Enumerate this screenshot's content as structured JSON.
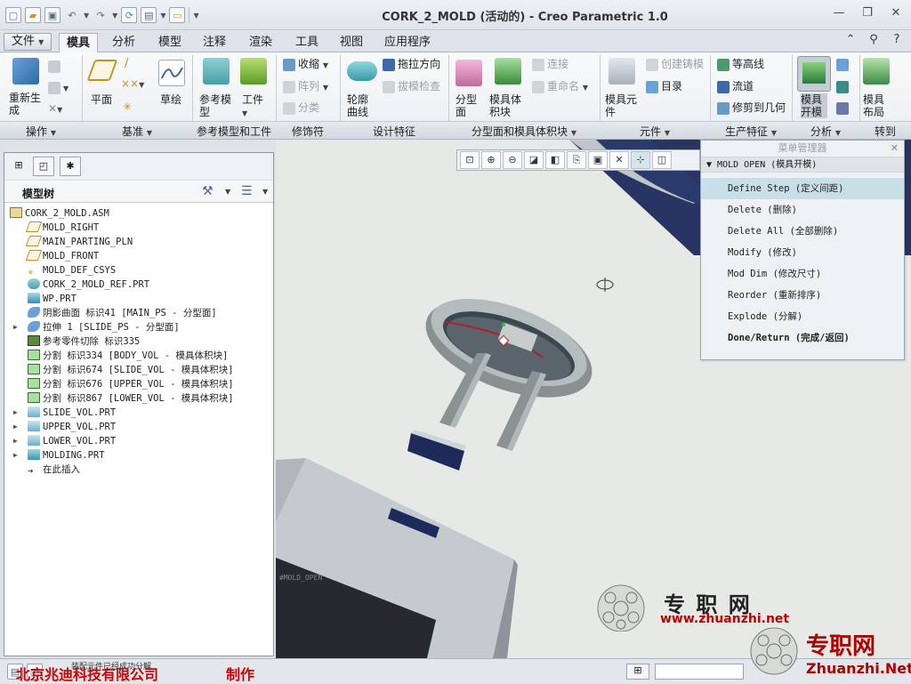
{
  "window": {
    "title": "CORK_2_MOLD (活动的) - Creo Parametric 1.0",
    "controls": [
      "—",
      "❐",
      "✕"
    ]
  },
  "qat": {
    "icons": [
      "new-file-icon",
      "open-folder-icon",
      "save-icon",
      "undo-icon",
      "redo-icon",
      "regenerate-icon",
      "windows-icon",
      "close-window-icon",
      "customize-icon"
    ]
  },
  "tabs": {
    "file": "文件",
    "items": [
      "模具",
      "分析",
      "模型",
      "注释",
      "渲染",
      "工具",
      "视图",
      "应用程序"
    ],
    "active": "模具"
  },
  "tab_icons": [
    "▲",
    "?",
    "◆",
    "?"
  ],
  "ribbon": {
    "regenerate": "重新生成",
    "plane": "平面",
    "sketch": "草绘",
    "ref_model": "参考模型",
    "workpiece": "工件",
    "shrink": "收缩",
    "array": "阵列",
    "classify": "分类",
    "outline_curve": "轮廓曲线",
    "pull_direction": "拖拉方向",
    "draft_check": "拔模检查",
    "parting_surface": "分型面",
    "mold_volume": "模具体积块",
    "connect": "连接",
    "rename": "重命名",
    "mold_component": "模具元件",
    "create_casting": "创建铸模",
    "directory": "目录",
    "contour": "等高线",
    "runner": "流道",
    "trim_to_geom": "修剪到几何",
    "mold_open": "模具开模",
    "mold_layout": "模具布局"
  },
  "groups": [
    "操作",
    "基准",
    "参考模型和工件",
    "修饰符",
    "设计特征",
    "分型面和模具体积块",
    "元件",
    "生产特征",
    "分析",
    "转到"
  ],
  "model_tree": {
    "title": "模型树",
    "items": [
      {
        "label": "CORK_2_MOLD.ASM",
        "icon": "assembly-icon",
        "indent": 0,
        "expander": false
      },
      {
        "label": "MOLD_RIGHT",
        "icon": "datum-plane-icon",
        "indent": 1,
        "expander": false
      },
      {
        "label": "MAIN_PARTING_PLN",
        "icon": "datum-plane-icon",
        "indent": 1,
        "expander": false
      },
      {
        "label": "MOLD_FRONT",
        "icon": "datum-plane-icon",
        "indent": 1,
        "expander": false
      },
      {
        "label": "MOLD_DEF_CSYS",
        "icon": "csys-icon",
        "indent": 1,
        "expander": false
      },
      {
        "label": "CORK_2_MOLD_REF.PRT",
        "icon": "ref-part-icon",
        "indent": 1,
        "expander": false
      },
      {
        "label": "WP.PRT",
        "icon": "workpiece-icon",
        "indent": 1,
        "expander": false
      },
      {
        "label": "阴影曲面 标识41 [MAIN_PS - 分型面]",
        "icon": "shadow-surface-icon",
        "indent": 1,
        "expander": false
      },
      {
        "label": "拉伸 1 [SLIDE_PS - 分型面]",
        "icon": "extrude-icon",
        "indent": 1,
        "expander": true
      },
      {
        "label": "参考零件切除 标识335",
        "icon": "ref-cut-icon",
        "indent": 1,
        "expander": false
      },
      {
        "label": "分割 标识334 [BODY_VOL - 模具体积块]",
        "icon": "split-icon",
        "indent": 1,
        "expander": false
      },
      {
        "label": "分割 标识674 [SLIDE_VOL - 模具体积块]",
        "icon": "split-icon",
        "indent": 1,
        "expander": false
      },
      {
        "label": "分割 标识676 [UPPER_VOL - 模具体积块]",
        "icon": "split-icon",
        "indent": 1,
        "expander": false
      },
      {
        "label": "分割 标识867 [LOWER_VOL - 模具体积块]",
        "icon": "split-icon",
        "indent": 1,
        "expander": false
      },
      {
        "label": "SLIDE_VOL.PRT",
        "icon": "part-icon",
        "indent": 1,
        "expander": true
      },
      {
        "label": "UPPER_VOL.PRT",
        "icon": "part-icon",
        "indent": 1,
        "expander": true
      },
      {
        "label": "LOWER_VOL.PRT",
        "icon": "part-icon",
        "indent": 1,
        "expander": true
      },
      {
        "label": "MOLDING.PRT",
        "icon": "molding-icon",
        "indent": 1,
        "expander": true
      },
      {
        "label": "在此插入",
        "icon": "insert-here-icon",
        "indent": 1,
        "expander": false
      }
    ]
  },
  "menu_manager": {
    "title": "菜单管理器",
    "header": "MOLD OPEN (模具开模)",
    "items": [
      {
        "label": "Define Step (定义间距)",
        "selected": true,
        "bold": false
      },
      {
        "label": "Delete (删除)",
        "selected": false,
        "bold": false
      },
      {
        "label": "Delete All (全部删除)",
        "selected": false,
        "bold": false
      },
      {
        "label": "Modify (修改)",
        "selected": false,
        "bold": false
      },
      {
        "label": "Mod Dim (修改尺寸)",
        "selected": false,
        "bold": false
      },
      {
        "label": "Reorder (重新排序)",
        "selected": false,
        "bold": false
      },
      {
        "label": "Explode (分解)",
        "selected": false,
        "bold": false
      },
      {
        "label": "Done/Return (完成/返回)",
        "selected": false,
        "bold": true
      }
    ]
  },
  "viewport": {
    "model_label": "#MOLD_OPEN"
  },
  "statusbar": {
    "company": "北京兆迪科技有限公司",
    "made_by": "制作",
    "message": "装配元件已经成功分解"
  },
  "watermark": {
    "site_cn": "专 职 网",
    "site_url": "www.zhuanzhi.net",
    "site_cn2": "专职网",
    "site_url2": "Zhuanzhi.Net"
  },
  "colors": {
    "accent": "#4a7ab0",
    "selected_menu": "#c9dfe8",
    "status_red": "#d40000"
  }
}
